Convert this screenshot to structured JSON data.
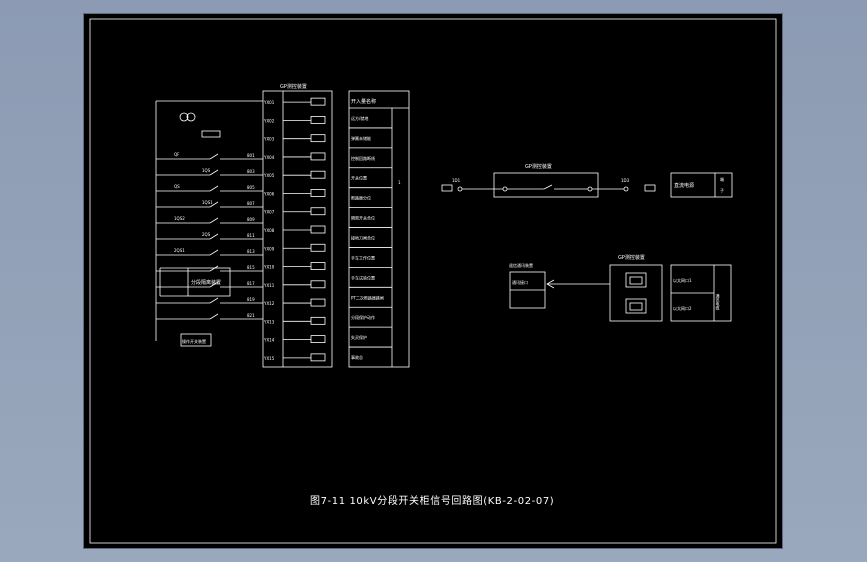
{
  "colors": {
    "background": "#9aa8bd",
    "sheet": "#000000",
    "line": "#ffffff"
  },
  "caption": "图7-11 10kV分段开关柜信号回路图(KB-2-02-07)",
  "left_panel": {
    "device_title": "GP测控装置",
    "column_header": "开入量名称",
    "signals": [
      "远方/就地",
      "弹簧未储能",
      "控制回路断线",
      "开关位置",
      "断路器分位",
      "隔离开关合位",
      "接地刀闸合位",
      "手车工作位置",
      "手车试验位置",
      "PT二次断路器跳闸",
      "分段保护动作",
      "失灵保护",
      "事故总"
    ],
    "terminals": [
      "YX01",
      "YX02",
      "YX03",
      "YX04",
      "YX05",
      "YX06",
      "YX07",
      "YX08",
      "YX09",
      "YX10",
      "YX11",
      "YX12",
      "YX13",
      "YX14",
      "YX15"
    ],
    "wire_numbers": [
      "801",
      "803",
      "805",
      "807",
      "809",
      "811",
      "813",
      "815",
      "817",
      "819",
      "821"
    ],
    "contact_labels": [
      "QF",
      "1QS",
      "QS",
      "1QS1",
      "1QS2",
      "2QS",
      "2QS1"
    ],
    "device_box": "分段隔离装置",
    "bottom_box": "操作开关装置",
    "gland_label": "1"
  },
  "right_top": {
    "device_title": "GP测控装置",
    "left_terminal": "1D1",
    "right_terminal": "1D3",
    "end_box": "直流电源",
    "side_labels": [
      "端",
      "子"
    ]
  },
  "right_bottom": {
    "source_title": "GP测控装置",
    "target_title": "遥信通讯装置",
    "target_label": "通讯接口",
    "port_labels": [
      "以太网口1",
      "以太网口2"
    ],
    "side_label": "通讯电缆"
  }
}
